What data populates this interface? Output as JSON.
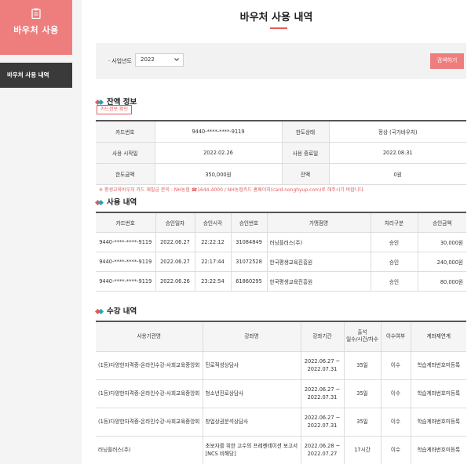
{
  "sidebar": {
    "header_title": "바우처 사용",
    "items": [
      {
        "label": "바우처 사용 내역"
      }
    ]
  },
  "page": {
    "title": "바우처 사용 내역"
  },
  "search": {
    "year_label": "사업년도",
    "year_value": "2022",
    "button_label": "검색하기"
  },
  "balance": {
    "section_title": "잔액 정보",
    "card_check_label": "카드정보 확인",
    "rows": [
      [
        "카드번호",
        "9440-****-****-9119",
        "한도상태",
        "정상 (국가바우처)"
      ],
      [
        "사용 시작일",
        "2022.02.26",
        "사용 종료일",
        "2022.08.31"
      ],
      [
        "한도금액",
        "350,000원",
        "잔액",
        "0원"
      ]
    ],
    "notice": "※ 평생교육바우처 카드 재발급 문의 : NH농협 ☎1644-4000 / NH농협카드 홈페이지(card.nonghyup.com)로 해주시기 바랍니다."
  },
  "usage": {
    "section_title": "사용 내역",
    "headers": [
      "카드번호",
      "승인일자",
      "승인시각",
      "승인번호",
      "가맹점명",
      "처리구분",
      "승인금액"
    ],
    "rows": [
      [
        "9440-****-****-9119",
        "2022.06.27",
        "22:22:12",
        "31084849",
        "러닝플러스(주)",
        "승인",
        "30,000원"
      ],
      [
        "9440-****-****-9119",
        "2022.06.27",
        "22:17:44",
        "31072528",
        "한국평생교육진흥원",
        "승인",
        "240,000원"
      ],
      [
        "9440-****-****-9119",
        "2022.06.26",
        "23:22:54",
        "61860295",
        "한국평생교육진흥원",
        "승인",
        "80,000원"
      ]
    ]
  },
  "courses": {
    "section_title": "수강 내역",
    "headers": [
      "사용기관명",
      "강좌명",
      "강좌기간",
      "출석\n일수/시간/차수",
      "이수여부",
      "계좌제연계"
    ],
    "rows": [
      [
        "(1등)다양한자격증-온라인수강-사회교육중앙회",
        "진로적성상담사",
        "2022.06.27 ~ 2022.07.31",
        "35일",
        "이수",
        "학습계좌번호미등록"
      ],
      [
        "(1등)다양한자격증-온라인수강-사회교육중앙회",
        "청소년진로상담사",
        "2022.06.27 ~ 2022.07.31",
        "35일",
        "이수",
        "학습계좌번호미등록"
      ],
      [
        "(1등)다양한자격증-온라인수강-사회교육중앙회",
        "창업상권분석상담사",
        "2022.06.27 ~ 2022.07.31",
        "35일",
        "이수",
        "학습계좌번호미등록"
      ],
      [
        "러닝플러스(주)",
        "초보자를 위한 고수의 프레젠테이션 보고서 [NCS 비해당]",
        "2022.06.28 ~ 2022.07.27",
        "17시간",
        "이수",
        "학습계좌번호미등록"
      ]
    ]
  },
  "colors": {
    "accent": "#ee7e7e",
    "dark": "#3a3a3a",
    "teal": "#2aa0b7"
  }
}
